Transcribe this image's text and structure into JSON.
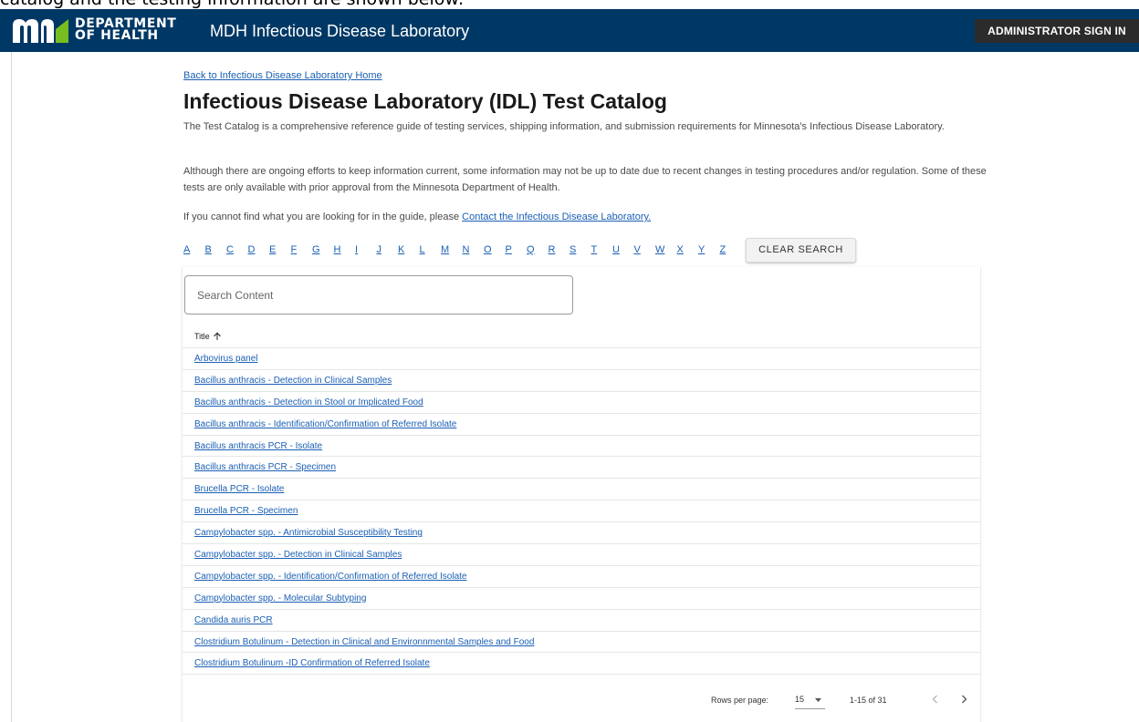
{
  "caption": "catalog and the testing information are shown below:",
  "header": {
    "logo_line1": "DEPARTMENT",
    "logo_line2": "OF HEALTH",
    "site_title": "MDH Infectious Disease Laboratory",
    "admin_button": "ADMINISTRATOR SIGN IN",
    "brand_color": "#003865"
  },
  "main": {
    "back_link": "Back to Infectious Disease Laboratory Home",
    "title": "Infectious Disease Laboratory (IDL) Test Catalog",
    "intro_1": "The Test Catalog is a comprehensive reference guide of testing services, shipping information, and submission requirements for Minnesota's Infectious Disease Laboratory.",
    "intro_2": "Although there are ongoing efforts to keep information current, some information may not be up to date due to recent changes in testing procedures and/or regulation. Some of these tests are only available with prior approval from the Minnesota Department of Health.",
    "intro_3_prefix": "If you cannot find what you are looking for in the guide, please ",
    "intro_3_link": "Contact the Infectious Disease Laboratory."
  },
  "alphabet": [
    "A",
    "B",
    "C",
    "D",
    "E",
    "F",
    "G",
    "H",
    "I",
    "J",
    "K",
    "L",
    "M",
    "N",
    "O",
    "P",
    "Q",
    "R",
    "S",
    "T",
    "U",
    "V",
    "W",
    "X",
    "Y",
    "Z"
  ],
  "clear_search": "CLEAR SEARCH",
  "search": {
    "placeholder": "Search Content",
    "value": ""
  },
  "table": {
    "column_title": "Title",
    "sort_icon": "arrow-up-icon",
    "rows": [
      "Arbovirus panel",
      "Bacillus anthracis - Detection in Clinical Samples",
      "Bacillus anthracis - Detection in Stool or Implicated Food",
      "Bacillus anthracis - Identification/Confirmation of Referred Isolate",
      "Bacillus anthracis PCR - Isolate",
      "Bacillus anthracis PCR - Specimen",
      "Brucella PCR - Isolate",
      "Brucella PCR - Specimen",
      "Campylobacter spp. - Antimicrobial Susceptibility Testing",
      "Campylobacter spp. - Detection in Clinical Samples",
      "Campylobacter spp. - Identification/Confirmation of Referred Isolate",
      "Campylobacter spp. - Molecular Subtyping",
      "Candida auris PCR",
      "Clostridium Botulinum - Detection in Clinical and Environnmental Samples and Food",
      "Clostridium Botulinum -ID Confirmation of Referred Isolate"
    ]
  },
  "pagination": {
    "rows_per_page_label": "Rows per page:",
    "rows_per_page": "15",
    "range": "1-15 of 31"
  }
}
